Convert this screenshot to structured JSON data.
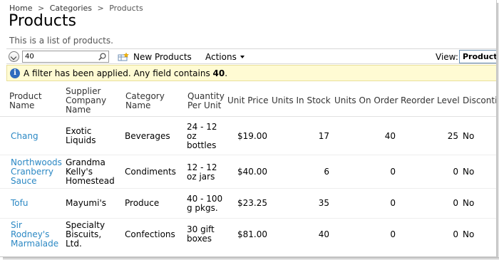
{
  "breadcrumb": {
    "home": "Home",
    "categories": "Categories",
    "separator": ">",
    "current": "Products"
  },
  "page": {
    "title": "Products",
    "description": "This is a list of products."
  },
  "toolbar": {
    "search_value": "40",
    "new_label": "New Products",
    "actions_label": "Actions",
    "view_label": "View:",
    "view_value": "Products"
  },
  "filter": {
    "prefix": "A filter has been applied. Any field contains ",
    "value": "40",
    "suffix": "."
  },
  "columns": {
    "product_name": [
      "Product",
      "Name"
    ],
    "supplier": [
      "Supplier",
      "Company",
      "Name"
    ],
    "category": [
      "Category",
      "Name"
    ],
    "quantity": [
      "Quantity",
      "Per Unit"
    ],
    "unit_price": "Unit Price",
    "units_in_stock": "Units In Stock",
    "units_on_order": "Units On Order",
    "reorder_level": "Reorder Level",
    "discontinued": "Discontinued"
  },
  "rows": [
    {
      "product": [
        "Chang"
      ],
      "supplier": [
        "Exotic",
        "Liquids"
      ],
      "category": "Beverages",
      "quantity": [
        "24 - 12",
        "oz",
        "bottles"
      ],
      "price": "$19.00",
      "stock": "17",
      "order": "40",
      "reorder": "25",
      "disc": "No"
    },
    {
      "product": [
        "Northwoods",
        "Cranberry",
        "Sauce"
      ],
      "supplier": [
        "Grandma",
        "Kelly's",
        "Homestead"
      ],
      "category": "Condiments",
      "quantity": [
        "12 - 12",
        "oz jars"
      ],
      "price": "$40.00",
      "stock": "6",
      "order": "0",
      "reorder": "0",
      "disc": "No"
    },
    {
      "product": [
        "Tofu"
      ],
      "supplier": [
        "Mayumi's"
      ],
      "category": "Produce",
      "quantity": [
        "40 - 100",
        "g pkgs."
      ],
      "price": "$23.25",
      "stock": "35",
      "order": "0",
      "reorder": "0",
      "disc": "No"
    },
    {
      "product": [
        "Sir",
        "Rodney's",
        "Marmalade"
      ],
      "supplier": [
        "Specialty",
        "Biscuits,",
        "Ltd."
      ],
      "category": "Confections",
      "quantity": [
        "30 gift",
        "boxes"
      ],
      "price": "$81.00",
      "stock": "40",
      "order": "0",
      "reorder": "0",
      "disc": "No"
    }
  ],
  "colors": {
    "link": "#2b88c4",
    "filter_bg": "#fffbd3",
    "info_icon": "#2d6bbe"
  },
  "icons": {
    "toggle": "chevron-down-icon",
    "search": "magnifier-icon",
    "new": "new-record-icon",
    "info": "info-icon"
  }
}
